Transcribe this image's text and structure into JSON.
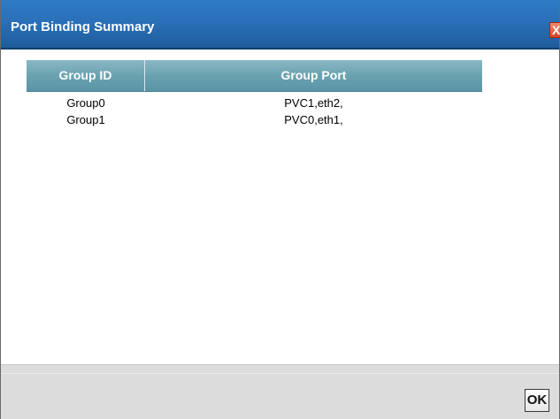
{
  "dialog": {
    "title": "Port Binding Summary",
    "close_glyph": "X",
    "ok_label": "OK"
  },
  "table": {
    "columns": [
      "Group ID",
      "Group Port"
    ],
    "rows": [
      {
        "group_id": "Group0",
        "group_port": "PVC1,eth2,"
      },
      {
        "group_id": "Group1",
        "group_port": "PVC0,eth1,"
      }
    ]
  },
  "colors": {
    "titlebar": "#2a70b8",
    "table_header": "#6ba2b1",
    "close_button": "#d8462c",
    "footer": "#dcdcdc"
  },
  "icons": {
    "close": "close-icon"
  }
}
